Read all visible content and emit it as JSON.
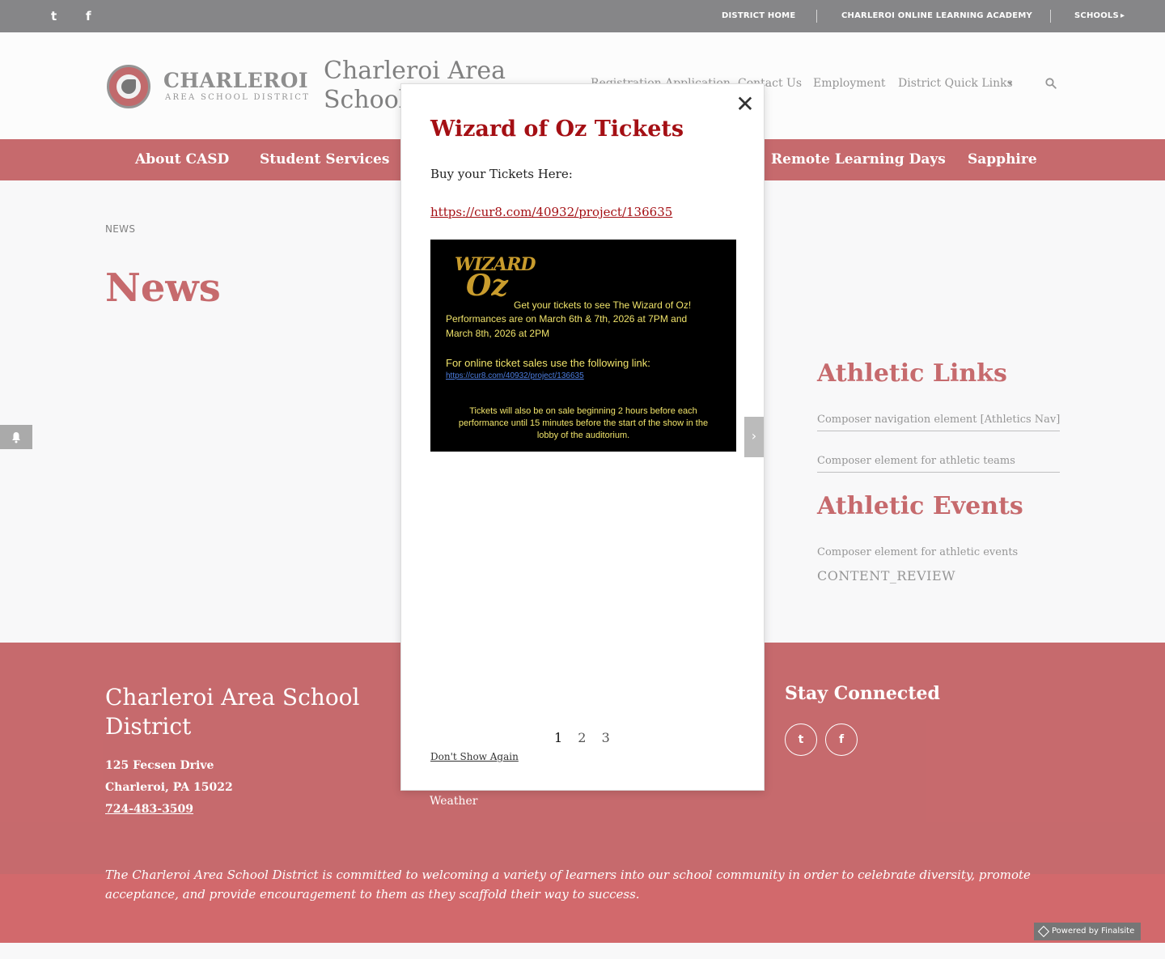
{
  "topbar": {
    "twitter_glyph": "t",
    "facebook_glyph": "f",
    "links": [
      "DISTRICT HOME",
      "CHARLEROI ONLINE LEARNING ACADEMY",
      "SCHOOLS"
    ],
    "schools_caret": "▸"
  },
  "header": {
    "logo_word": "CHARLEROI",
    "logo_sub": "AREA SCHOOL DISTRICT",
    "site_title": "Charleroi Area School",
    "nav": [
      "Registration Application",
      "Contact Us",
      "Employment",
      "District Quick Links"
    ],
    "quick_links_caret": "▾"
  },
  "mainnav": [
    "About CASD",
    "Student Services",
    "Remote Learning Days",
    "Sapphire"
  ],
  "content": {
    "breadcrumb": "NEWS",
    "page_title": "News"
  },
  "sidebar": {
    "athletic_links_title": "Athletic Links",
    "nav_element": "Composer navigation element [Athletics Nav]",
    "teams_element": "Composer element for athletic teams",
    "athletic_events_title": "Athletic Events",
    "events_element": "Composer element for athletic events",
    "review": "CONTENT_REVIEW"
  },
  "footer": {
    "title": "Charleroi Area School District",
    "address1": "125 Fecsen Drive",
    "address2": "Charleroi, PA  15022",
    "phone": "724-483-3509",
    "weather": "Weather",
    "stay_connected": "Stay Connected",
    "mission": "The Charleroi Area School District is committed to welcoming a variety of learners into our school community in order to celebrate diversity, promote acceptance, and provide encouragement to them as they scaffold their way to success.",
    "powered": "Powered by Finalsite"
  },
  "modal": {
    "close_glyph": "✕",
    "title": "Wizard of Oz Tickets",
    "text": "Buy your Tickets Here:",
    "link": "https://cur8.com/40932/project/136635",
    "flyer": {
      "logo_top": "WIZARD",
      "logo_bottom": "Oz",
      "line1": "Get your tickets to see The Wizard of Oz!",
      "line2": "Performances are on March 6th & 7th, 2026 at 7PM  and",
      "line3": "March 8th, 2026 at 2PM",
      "line4": "For online ticket sales use the following link:",
      "link": "https://cur8.com/40932/project/136635",
      "line5": "Tickets will also be on sale beginning 2 hours before each",
      "line6": "performance until 15 minutes before the start of the show in the",
      "line7": "lobby of the auditorium."
    },
    "pages": [
      "1",
      "2",
      "3"
    ],
    "dont_show": "Don't Show Again",
    "next_glyph": "›"
  },
  "colors": {
    "brand_red": "#a40f14",
    "footer_band": "#b70e12",
    "topbar": "#3d3d3f"
  }
}
